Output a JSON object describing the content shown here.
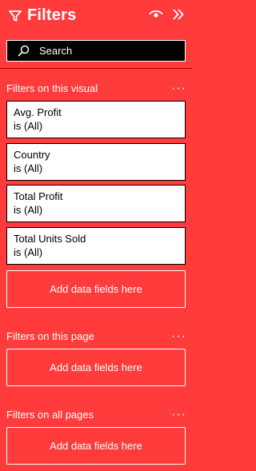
{
  "header": {
    "title": "Filters",
    "icons": [
      "funnel-icon",
      "eye-icon",
      "double-chevron-right-icon"
    ]
  },
  "search": {
    "placeholder": "Search"
  },
  "sections": {
    "visual": {
      "label": "Filters on this visual",
      "more": "···",
      "filters": [
        {
          "name": "Avg. Profit",
          "state": "is (All)"
        },
        {
          "name": "Country",
          "state": "is (All)"
        },
        {
          "name": "Total Profit",
          "state": "is (All)"
        },
        {
          "name": "Total Units Sold",
          "state": "is (All)"
        }
      ],
      "drop_label": "Add data fields here"
    },
    "page": {
      "label": "Filters on this page",
      "more": "···",
      "drop_label": "Add data fields here"
    },
    "all_pages": {
      "label": "Filters on all pages",
      "more": "···",
      "drop_label": "Add data fields here"
    }
  },
  "colors": {
    "pane_bg": "#ff3b3b",
    "card_bg": "#ffffff",
    "search_bg": "#000000"
  }
}
